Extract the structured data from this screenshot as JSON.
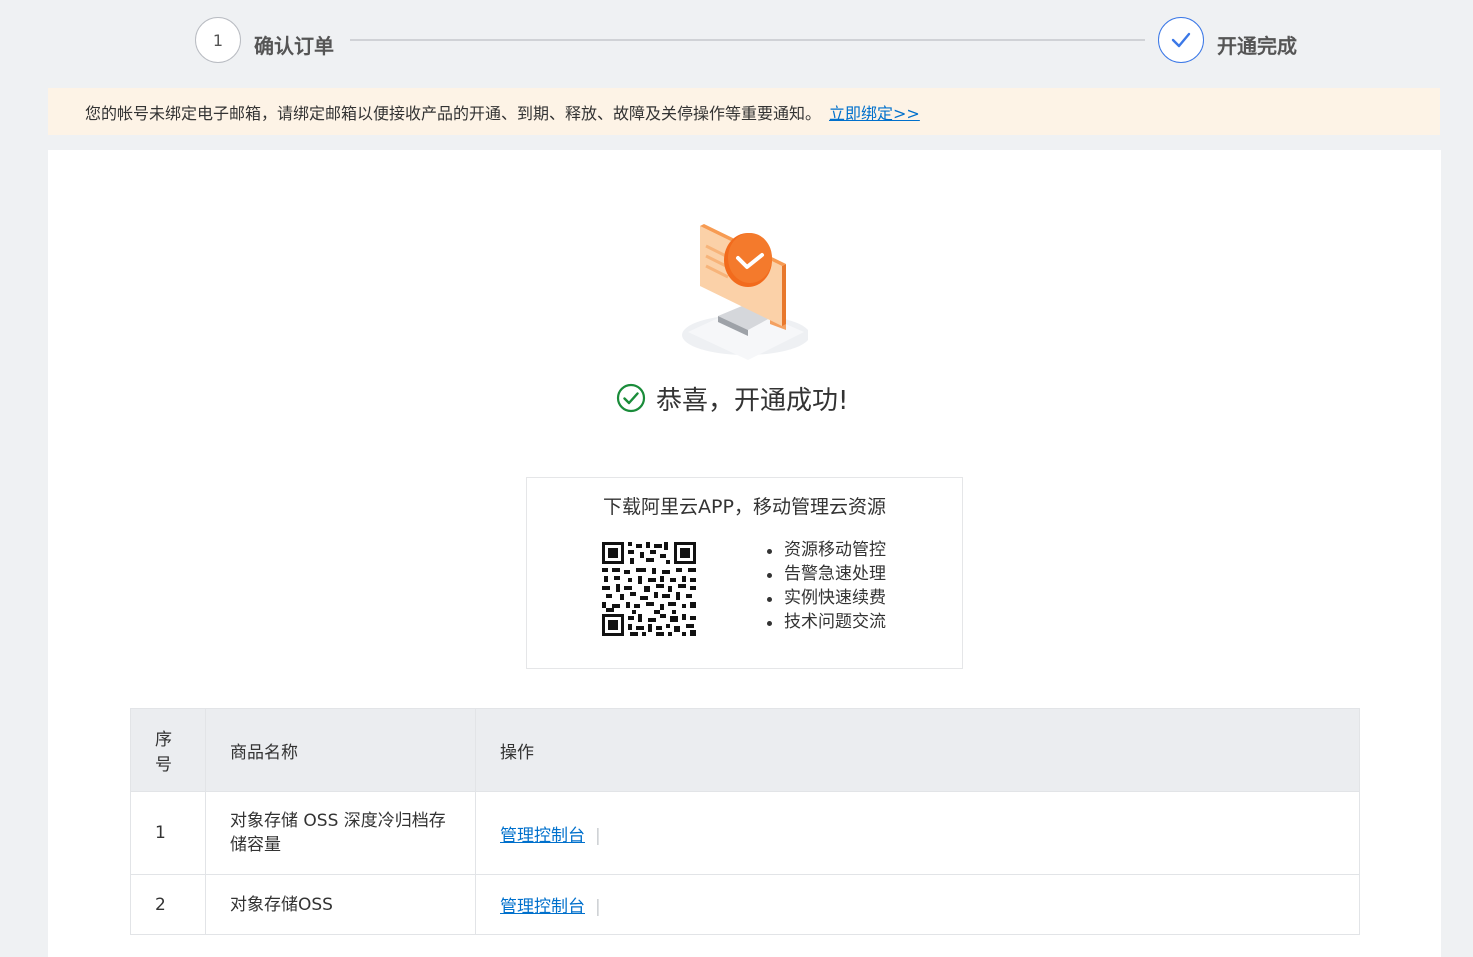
{
  "steps": [
    {
      "number": "1",
      "label": "确认订单"
    },
    {
      "label": "开通完成"
    }
  ],
  "notice": {
    "text": "您的帐号未绑定电子邮箱，请绑定邮箱以便接收产品的开通、到期、释放、故障及关停操作等重要通知。",
    "link": "立即绑定>>"
  },
  "success": {
    "text": "恭喜，开通成功!"
  },
  "app_promo": {
    "title": "下载阿里云APP，移动管理云资源",
    "features": [
      "资源移动管控",
      "告警急速处理",
      "实例快速续费",
      "技术问题交流"
    ]
  },
  "table": {
    "headers": [
      "序号",
      "商品名称",
      "操作"
    ],
    "rows": [
      {
        "index": "1",
        "name": "对象存储 OSS 深度冷归档存储容量",
        "action": "管理控制台",
        "separator": "|"
      },
      {
        "index": "2",
        "name": "对象存储OSS",
        "action": "管理控制台",
        "separator": "|"
      }
    ]
  },
  "colors": {
    "accent": "#3b78e7",
    "link": "#0070cc",
    "success": "#1a8c3a",
    "notice_bg": "#fdf3e6",
    "illustration": "#f26b1d"
  }
}
